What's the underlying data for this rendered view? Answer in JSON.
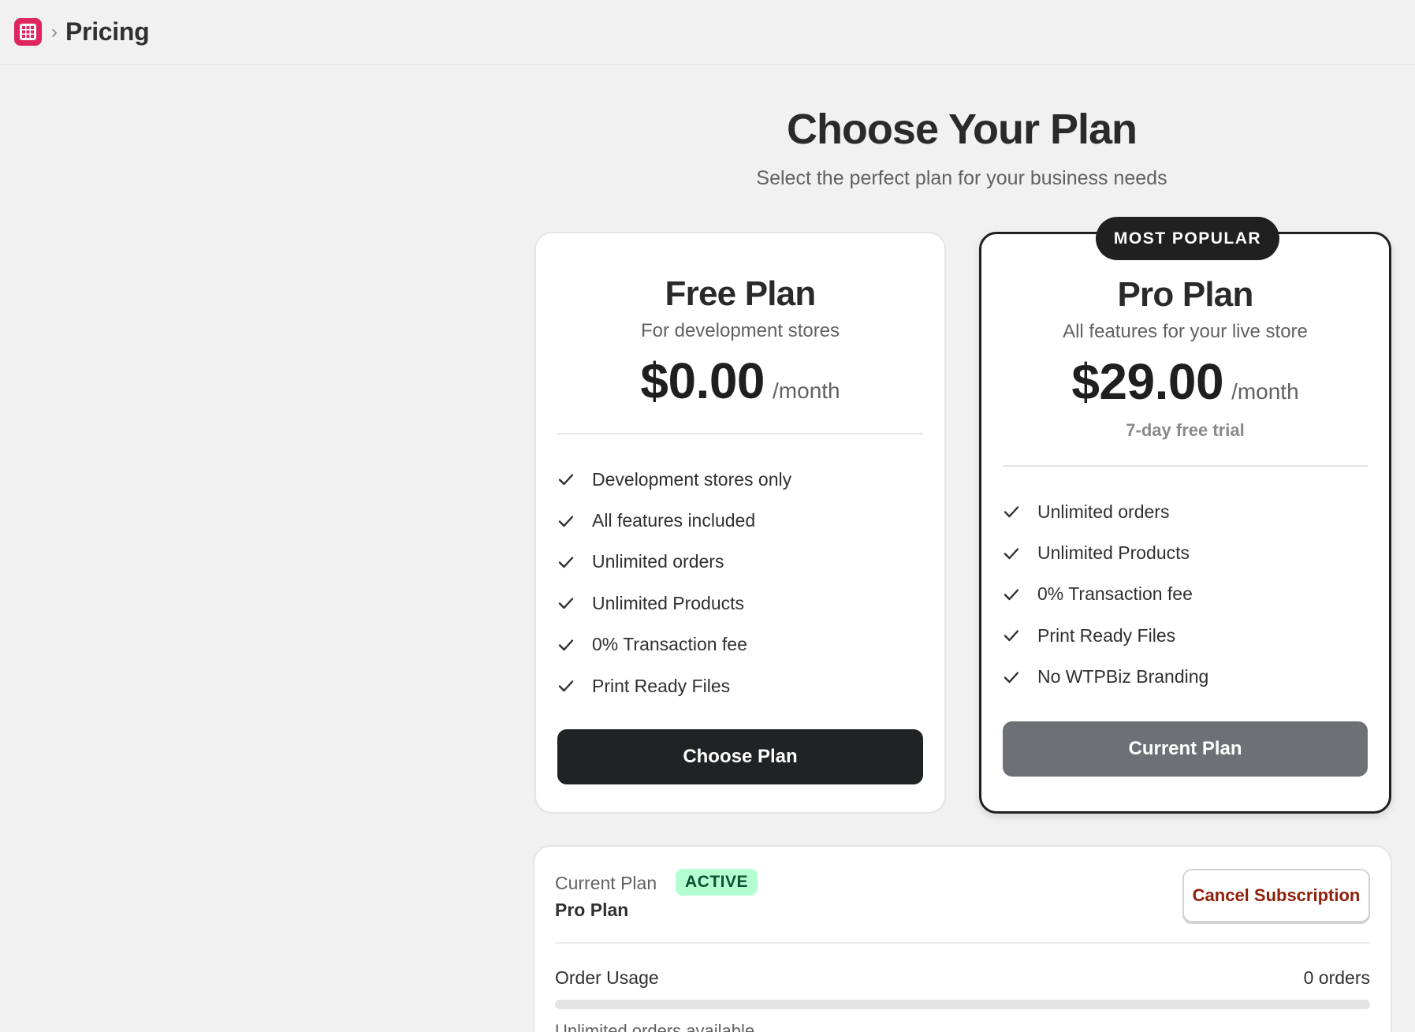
{
  "header": {
    "app_icon": "grid-app-icon",
    "separator": "›",
    "title": "Pricing"
  },
  "hero": {
    "title": "Choose Your Plan",
    "subtitle": "Select the perfect plan for your business needs"
  },
  "plans": {
    "free": {
      "name": "Free Plan",
      "description": "For development stores",
      "price": "$0.00",
      "period": "/month",
      "features": [
        "Development stores only",
        "All features included",
        "Unlimited orders",
        "Unlimited Products",
        "0% Transaction fee",
        "Print Ready Files"
      ],
      "button_label": "Choose Plan"
    },
    "pro": {
      "badge": "MOST POPULAR",
      "name": "Pro Plan",
      "description": "All features for your live store",
      "price": "$29.00",
      "period": "/month",
      "trial": "7-day free trial",
      "features": [
        "Unlimited orders",
        "Unlimited Products",
        "0% Transaction fee",
        "Print Ready Files",
        "No WTPBiz Branding"
      ],
      "button_label": "Current Plan"
    }
  },
  "subscription": {
    "label": "Current Plan",
    "status": "ACTIVE",
    "plan_name": "Pro Plan",
    "cancel_label": "Cancel Subscription",
    "usage_label": "Order Usage",
    "usage_value": "0 orders",
    "usage_fraction": 0,
    "usage_note": "Unlimited orders available"
  },
  "colors": {
    "app_icon": "#e0245e",
    "active_badge_bg": "#b4fed2",
    "active_badge_text": "#0c5132",
    "cancel_text": "#8e1f0b",
    "primary_button": "#202224",
    "disabled_button": "#6d7175"
  }
}
